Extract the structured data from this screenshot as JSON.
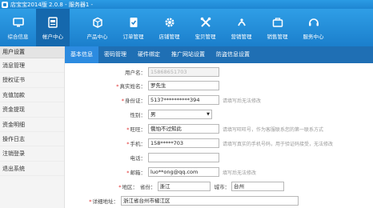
{
  "window": {
    "title": "店宝宝2014版 2.0.8 - 服务器1 -"
  },
  "toolbar": {
    "items": [
      {
        "label": "综合信息",
        "icon": "monitor-icon"
      },
      {
        "label": "帐户中心",
        "icon": "account-book-icon"
      },
      {
        "label": "产品中心",
        "icon": "box-icon"
      },
      {
        "label": "订单管理",
        "icon": "order-icon"
      },
      {
        "label": "店铺管理",
        "icon": "shop-gear-icon"
      },
      {
        "label": "宝贝管理",
        "icon": "tools-icon"
      },
      {
        "label": "营销管理",
        "icon": "marketing-icon"
      },
      {
        "label": "销售管理",
        "icon": "sales-icon"
      },
      {
        "label": "服务中心",
        "icon": "service-icon"
      }
    ]
  },
  "sidebar": {
    "header": "用户设置",
    "items": [
      "消息管理",
      "授权证书",
      "充值加款",
      "资金提现",
      "资金明细",
      "操作日志",
      "注销登录",
      "退出系统"
    ]
  },
  "subtabs": [
    "基本信息",
    "密码管理",
    "硬件绑定",
    "推广网站设置",
    "防盗信息设置"
  ],
  "form": {
    "username": {
      "label": "用户名：",
      "value": "15868651703"
    },
    "realname": {
      "label": "真实姓名：",
      "value": "罗先生"
    },
    "idcard": {
      "label": "身份证：",
      "value": "5137**********394",
      "hint": "请填写后无法修改"
    },
    "gender": {
      "label": "性别：",
      "value": "男"
    },
    "nickname": {
      "label": "旺旺：",
      "value": "俄怕不过知此",
      "hint": "请填写旺旺号，作为客服联系您的第一联系方式"
    },
    "mobile": {
      "label": "手机：",
      "value": "158*****703",
      "hint": "请填写真实的手机号码，用于验证码接受，无法修改"
    },
    "phone": {
      "label": "电话：",
      "value": ""
    },
    "email": {
      "label": "邮箱：",
      "value": "luo**ong@qq.com",
      "hint": "填写后无法修改"
    },
    "region": {
      "label": "地区：",
      "province_label": "省份：",
      "province": "浙江",
      "city_label": "城市：",
      "city": "台州"
    },
    "address": {
      "label": "详细地址：",
      "value": "浙江省台州市椒江区"
    }
  },
  "colors": {
    "toolbar": "#1e86d2",
    "active": "#1568ad",
    "subtab_bar": "#1f6fb4",
    "required": "#e02a2a"
  }
}
